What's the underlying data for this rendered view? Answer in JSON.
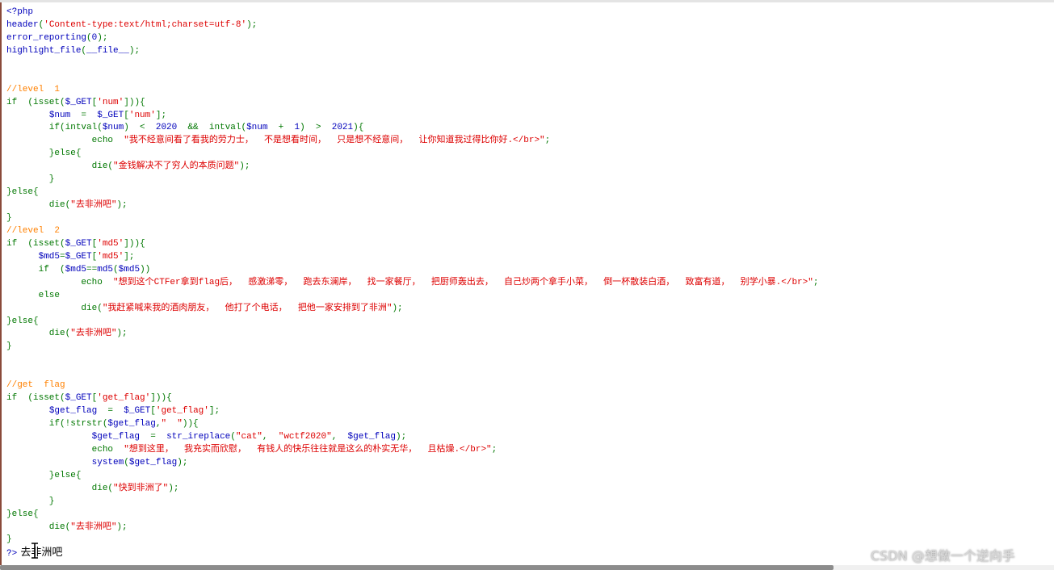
{
  "colors": {
    "keyword": "#007700",
    "default": "#0000BB",
    "string": "#DD0000",
    "comment": "#FF8000"
  },
  "lines": [
    [
      [
        "v",
        "<?php"
      ]
    ],
    [
      [
        "v",
        "header"
      ],
      [
        "k",
        "("
      ],
      [
        "s",
        "'Content-type:text/html;charset=utf-8'"
      ],
      [
        "k",
        ");"
      ]
    ],
    [
      [
        "v",
        "error_reporting"
      ],
      [
        "k",
        "("
      ],
      [
        "v",
        "0"
      ],
      [
        "k",
        ");"
      ]
    ],
    [
      [
        "v",
        "highlight_file"
      ],
      [
        "k",
        "("
      ],
      [
        "v",
        "__file__"
      ],
      [
        "k",
        ");"
      ]
    ],
    [],
    [],
    [
      [
        "c",
        "//level  1"
      ]
    ],
    [
      [
        "k",
        "if  (isset("
      ],
      [
        "v",
        "$_GET"
      ],
      [
        "k",
        "["
      ],
      [
        "s",
        "'num'"
      ],
      [
        "k",
        "])){"
      ]
    ],
    [
      [
        "k",
        "        "
      ],
      [
        "v",
        "$num"
      ],
      [
        "k",
        "  =  "
      ],
      [
        "v",
        "$_GET"
      ],
      [
        "k",
        "["
      ],
      [
        "s",
        "'num'"
      ],
      [
        "k",
        "];"
      ]
    ],
    [
      [
        "k",
        "        if(intval("
      ],
      [
        "v",
        "$num"
      ],
      [
        "k",
        ")  <  "
      ],
      [
        "v",
        "2020"
      ],
      [
        "k",
        "  &&  intval("
      ],
      [
        "v",
        "$num"
      ],
      [
        "k",
        "  +  "
      ],
      [
        "v",
        "1"
      ],
      [
        "k",
        ")  >  "
      ],
      [
        "v",
        "2021"
      ],
      [
        "k",
        "){"
      ]
    ],
    [
      [
        "k",
        "                echo  "
      ],
      [
        "s",
        "\"我不经意间看了看我的劳力士，  不是想看时间，  只是想不经意间，  让你知道我过得比你好.</br>\""
      ],
      [
        "k",
        ";"
      ]
    ],
    [
      [
        "k",
        "        }else{"
      ]
    ],
    [
      [
        "k",
        "                die("
      ],
      [
        "s",
        "\"金钱解决不了穷人的本质问题\""
      ],
      [
        "k",
        ");"
      ]
    ],
    [
      [
        "k",
        "        }"
      ]
    ],
    [
      [
        "k",
        "}else{"
      ]
    ],
    [
      [
        "k",
        "        die("
      ],
      [
        "s",
        "\"去非洲吧\""
      ],
      [
        "k",
        ");"
      ]
    ],
    [
      [
        "k",
        "}"
      ]
    ],
    [
      [
        "c",
        "//level  2"
      ]
    ],
    [
      [
        "k",
        "if  (isset("
      ],
      [
        "v",
        "$_GET"
      ],
      [
        "k",
        "["
      ],
      [
        "s",
        "'md5'"
      ],
      [
        "k",
        "])){"
      ]
    ],
    [
      [
        "k",
        "      "
      ],
      [
        "v",
        "$md5"
      ],
      [
        "k",
        "="
      ],
      [
        "v",
        "$_GET"
      ],
      [
        "k",
        "["
      ],
      [
        "s",
        "'md5'"
      ],
      [
        "k",
        "];"
      ]
    ],
    [
      [
        "k",
        "      if  ("
      ],
      [
        "v",
        "$md5"
      ],
      [
        "k",
        "=="
      ],
      [
        "v",
        "md5"
      ],
      [
        "k",
        "("
      ],
      [
        "v",
        "$md5"
      ],
      [
        "k",
        "))"
      ]
    ],
    [
      [
        "k",
        "              echo  "
      ],
      [
        "s",
        "\"想到这个CTFer拿到flag后，  感激涕零，  跑去东澜岸，  找一家餐厅，  把厨师轰出去，  自己炒两个拿手小菜，  倒一杯散装白酒，  致富有道，  别学小暴.</br>\""
      ],
      [
        "k",
        ";"
      ]
    ],
    [
      [
        "k",
        "      else"
      ]
    ],
    [
      [
        "k",
        "              die("
      ],
      [
        "s",
        "\"我赶紧喊来我的酒肉朋友，  他打了个电话，  把他一家安排到了非洲\""
      ],
      [
        "k",
        ");"
      ]
    ],
    [
      [
        "k",
        "}else{"
      ]
    ],
    [
      [
        "k",
        "        die("
      ],
      [
        "s",
        "\"去非洲吧\""
      ],
      [
        "k",
        ");"
      ]
    ],
    [
      [
        "k",
        "}"
      ]
    ],
    [],
    [],
    [
      [
        "c",
        "//get  flag"
      ]
    ],
    [
      [
        "k",
        "if  (isset("
      ],
      [
        "v",
        "$_GET"
      ],
      [
        "k",
        "["
      ],
      [
        "s",
        "'get_flag'"
      ],
      [
        "k",
        "])){"
      ]
    ],
    [
      [
        "k",
        "        "
      ],
      [
        "v",
        "$get_flag"
      ],
      [
        "k",
        "  =  "
      ],
      [
        "v",
        "$_GET"
      ],
      [
        "k",
        "["
      ],
      [
        "s",
        "'get_flag'"
      ],
      [
        "k",
        "];"
      ]
    ],
    [
      [
        "k",
        "        if(!strstr("
      ],
      [
        "v",
        "$get_flag"
      ],
      [
        "k",
        ","
      ],
      [
        "s",
        "\"  \""
      ],
      [
        "k",
        ")){"
      ]
    ],
    [
      [
        "k",
        "                "
      ],
      [
        "v",
        "$get_flag"
      ],
      [
        "k",
        "  =  "
      ],
      [
        "v",
        "str_ireplace"
      ],
      [
        "k",
        "("
      ],
      [
        "s",
        "\"cat\""
      ],
      [
        "k",
        ",  "
      ],
      [
        "s",
        "\"wctf2020\""
      ],
      [
        "k",
        ",  "
      ],
      [
        "v",
        "$get_flag"
      ],
      [
        "k",
        ");"
      ]
    ],
    [
      [
        "k",
        "                echo  "
      ],
      [
        "s",
        "\"想到这里，  我充实而欣慰，  有钱人的快乐往往就是这么的朴实无华，  且枯燥.</br>\""
      ],
      [
        "k",
        ";"
      ]
    ],
    [
      [
        "k",
        "                "
      ],
      [
        "v",
        "system"
      ],
      [
        "k",
        "("
      ],
      [
        "v",
        "$get_flag"
      ],
      [
        "k",
        ");"
      ]
    ],
    [
      [
        "k",
        "        }else{"
      ]
    ],
    [
      [
        "k",
        "                die("
      ],
      [
        "s",
        "\"快到非洲了\""
      ],
      [
        "k",
        ");"
      ]
    ],
    [
      [
        "k",
        "        }"
      ]
    ],
    [
      [
        "k",
        "}else{"
      ]
    ],
    [
      [
        "k",
        "        die("
      ],
      [
        "s",
        "\"去非洲吧\""
      ],
      [
        "k",
        ");"
      ]
    ],
    [
      [
        "k",
        "}"
      ]
    ],
    [
      [
        "v",
        "?>"
      ],
      [
        "d",
        " 去非洲吧"
      ]
    ]
  ],
  "watermark": "CSDN @想做一个逆向手"
}
